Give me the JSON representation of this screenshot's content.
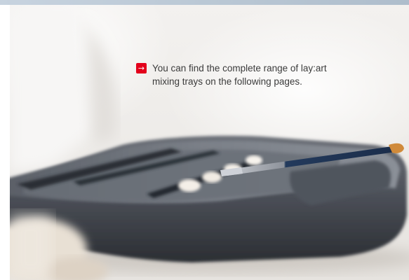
{
  "callout": {
    "text_line1": "You can find the complete range of lay:art",
    "text_line2": "mixing trays on the following pages.",
    "arrow_icon": "right-arrow-icon",
    "arrow_glyph": "→"
  },
  "colors": {
    "accent": "#e3001b",
    "text": "#3b3b3b",
    "top_strip": "#bccad7"
  },
  "photo": {
    "subject": "dental ceramic mixing tray with brush"
  }
}
